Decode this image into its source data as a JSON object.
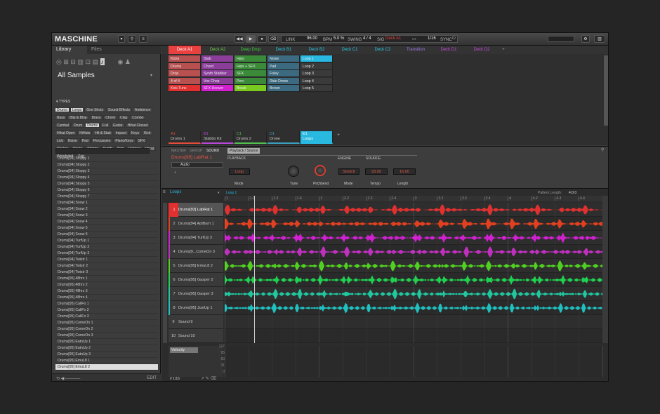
{
  "header": {
    "logo": "MASCHINE",
    "link": "LINK",
    "bpm_value": "96.00",
    "bpm_unit": "BPM",
    "swing_value": "5.0 %",
    "swing_unit": "SWING",
    "sig": "4 / 4",
    "sig_unit": "SIG",
    "scene": "Deck A1",
    "grid": "1/16",
    "sync": "SYNC"
  },
  "browser": {
    "tabs": [
      "Library",
      "Files"
    ],
    "title": "All Samples",
    "types_label": "▾ TYPES",
    "tags": [
      "Drums",
      "Loops",
      "One Shots",
      "Sound Effects",
      "Ambience",
      "Bass",
      "Blip & Blop",
      "Brass",
      "Chord",
      "Clap",
      "Combo",
      "Cymbal",
      "Drum",
      "Drums",
      "Full",
      "Guitar",
      "Hihat Closed",
      "Hihat Open",
      "HiHats",
      "Hit & Stab",
      "Impact",
      "Keys",
      "Kick",
      "Lick",
      "Noise",
      "Pad",
      "Percussion",
      "Piano/Keys",
      "SFX",
      "Shaker",
      "Snare",
      "Strings",
      "Synth",
      "Tom",
      "Various",
      "Vocal",
      "Woodwind",
      "Zap"
    ],
    "selected_tags": [
      "Loops",
      "Drums"
    ],
    "files": [
      "Drums[94] Sloppy 1",
      "Drums[94] Sloppy 2",
      "Drums[94] Sloppy 3",
      "Drums[94] Sloppy 4",
      "Drums[94] Sloppy 5",
      "Drums[94] Sloppy 6",
      "Drums[94] Sloppy 7",
      "Drums[94] Snow 1",
      "Drums[94] Snow 2",
      "Drums[94] Snow 3",
      "Drums[94] Snow 4",
      "Drums[94] Snow 5",
      "Drums[94] Snow 6",
      "Drums[94] TurfUp 1",
      "Drums[94] TurfUp 2",
      "Drums[94] TurfUp 3",
      "Drums[94] Twistr 1",
      "Drums[94] Twistr 2",
      "Drums[94] Twistr 3",
      "Drums[95] 48hrs 1",
      "Drums[95] 48hrs 2",
      "Drums[95] 48hrs 3",
      "Drums[95] 48hrs 4",
      "Drums[95] CaliFo 1",
      "Drums[95] CaliFo 2",
      "Drums[95] CaliFo 3",
      "Drums[95] ComeOn 1",
      "Drums[95] ComeOn 2",
      "Drums[95] ComeOn 3",
      "Drums[95] EatnUp 1",
      "Drums[95] EatnUp 2",
      "Drums[95] EatnUp 3",
      "Drums[95] EmuL8 1",
      "Drums[95] EmuL8 2"
    ],
    "selected_file": "Drums[95] EmuL8 2"
  },
  "scenes": [
    "Deck A1",
    "Deck A2",
    "Deep Drop",
    "Deck B1",
    "Deck B2",
    "Deck C1",
    "Deck C2",
    "Transition",
    "Deck D1",
    "Deck D2"
  ],
  "scene_colors": [
    "#e94040",
    "#6fd04a",
    "#3fcf3f",
    "#29c8e6",
    "#29c8e6",
    "#29c8e6",
    "#29c8e6",
    "#9f7be8",
    "#c94be0",
    "#c94be0"
  ],
  "pattern_cols": [
    {
      "color": "#b85050",
      "items": [
        "Kicks",
        "Drums",
        "Drop",
        "4 of 4",
        "Kick Tuns"
      ]
    },
    {
      "color": "#8a3e9a",
      "items": [
        "Stab",
        "Chord",
        "Synth Stabber",
        "Vox Chop",
        "SFX Hoover"
      ]
    },
    {
      "color": "#3a8a3a",
      "items": [
        "Hats",
        "Hats + SFX",
        "SFX",
        "Perc",
        "Break"
      ]
    },
    {
      "color": "#3c6a80",
      "items": [
        "Noise",
        "Pad",
        "Foley",
        "Ride Drone",
        "Brown"
      ]
    },
    {
      "color": "#3a3a3a",
      "items": [
        "Loop 1",
        "Loop 2",
        "Loop 3",
        "Loop 4",
        "Loop 5"
      ]
    }
  ],
  "groups": [
    {
      "id": "A1",
      "name": "Drums 1",
      "color": "#e34a3a"
    },
    {
      "id": "B1",
      "name": "Stabbo Kit",
      "color": "#b648d8"
    },
    {
      "id": "C1",
      "name": "Drums 2",
      "color": "#4fc04f"
    },
    {
      "id": "D1",
      "name": "Drone",
      "color": "#3aa0c0"
    },
    {
      "id": "E1",
      "name": "Loops",
      "color": "#29b8e0"
    }
  ],
  "control": {
    "tabs": [
      "MASTER",
      "GROUP",
      "SOUND"
    ],
    "page": "Playback / Source",
    "sound_name": "Drums[95] LabRat 1",
    "module": "Audio",
    "sections": [
      "PLAYBACK",
      "ENGINE",
      "SOURCE"
    ],
    "params": [
      {
        "label": "Mode",
        "value": "Loop"
      },
      {
        "label": "Tune",
        "value": ""
      },
      {
        "label": "Pitchbend",
        "value": ""
      },
      {
        "label": "Mode",
        "value": "Stretch"
      },
      {
        "label": "Tempo",
        "value": "93.00"
      },
      {
        "label": "Length",
        "value": "16.00"
      }
    ]
  },
  "pattern": {
    "group": "Loops",
    "name": "Loop 1",
    "length_label": "Pattern Length:",
    "length": "4:0:0",
    "ruler": [
      "1",
      "1.2",
      "1.3",
      "1.4",
      "2",
      "2.2",
      "2.3",
      "2.4",
      "3",
      "3.2",
      "3.3",
      "3.4",
      "4",
      "4.2",
      "4.3",
      "4.4"
    ],
    "sounds": [
      {
        "n": "1",
        "name": "Drums[93] LabRat 1",
        "color": "#e03030"
      },
      {
        "n": "2",
        "name": "Drums[94] AplBurn 1",
        "color": "#e04020"
      },
      {
        "n": "3",
        "name": "Drums[94] TurfUp 3",
        "color": "#d020d0"
      },
      {
        "n": "4",
        "name": "Drums[9...ComeOn 3",
        "color": "#c030c0"
      },
      {
        "n": "5",
        "name": "Drums[95] EmuL8 2",
        "color": "#50d020"
      },
      {
        "n": "6",
        "name": "Drums[95] Gasper 2",
        "color": "#20d050"
      },
      {
        "n": "7",
        "name": "Drums[95] Gasper 3",
        "color": "#20c8a0"
      },
      {
        "n": "8",
        "name": "Drums[95] JustUp 1",
        "color": "#20c0c0"
      },
      {
        "n": "9",
        "name": "Sound 9",
        "color": ""
      },
      {
        "n": "10",
        "name": "Sound 10",
        "color": ""
      }
    ],
    "velocity_label": "Velocity",
    "vel_ticks": [
      "127",
      "95",
      "63",
      "31",
      "0"
    ],
    "step": "1/16"
  }
}
